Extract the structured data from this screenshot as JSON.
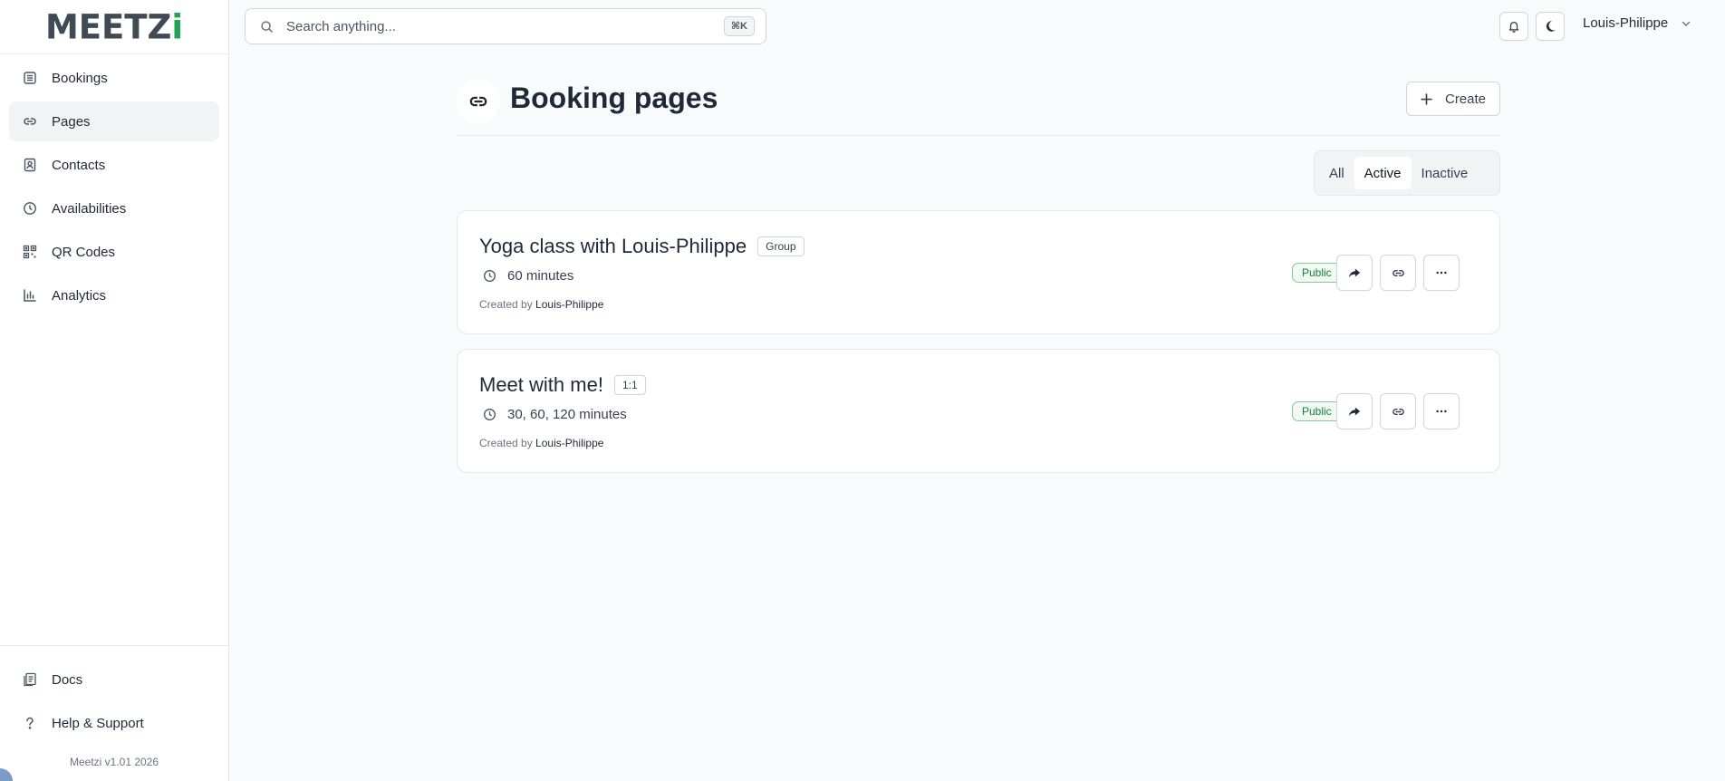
{
  "app": {
    "logo_main": "MEETZ",
    "logo_accent": "i",
    "version": "Meetzi v1.01 2026"
  },
  "sidebar": {
    "items": [
      {
        "label": "Bookings",
        "icon": "bookings-icon",
        "active": false
      },
      {
        "label": "Pages",
        "icon": "link-icon",
        "active": true
      },
      {
        "label": "Contacts",
        "icon": "contacts-icon",
        "active": false
      },
      {
        "label": "Availabilities",
        "icon": "clock-icon",
        "active": false
      },
      {
        "label": "QR Codes",
        "icon": "qr-code-icon",
        "active": false
      },
      {
        "label": "Analytics",
        "icon": "bar-chart-icon",
        "active": false
      }
    ],
    "bottom_items": [
      {
        "label": "Docs",
        "icon": "docs-icon"
      },
      {
        "label": "Help & Support",
        "icon": "question-icon"
      }
    ]
  },
  "header": {
    "search_placeholder": "Search anything...",
    "search_shortcut": "⌘K",
    "user_name": "Louis-Philippe"
  },
  "main": {
    "title": "Booking pages",
    "create_label": "Create",
    "filters": [
      {
        "label": "All",
        "active": false
      },
      {
        "label": "Active",
        "active": true
      },
      {
        "label": "Inactive",
        "active": false
      }
    ],
    "pages": [
      {
        "title": "Yoga class with Louis-Philippe",
        "type": "Group",
        "duration": "60 minutes",
        "created_prefix": "Created by",
        "author": "Louis-Philippe",
        "status": "Public"
      },
      {
        "title": "Meet with me!",
        "type": "1:1",
        "duration": "30, 60, 120 minutes",
        "created_prefix": "Created by",
        "author": "Louis-Philippe",
        "status": "Public"
      }
    ]
  },
  "colors": {
    "accent_green": "#22a455",
    "logo_gray": "#3f4a55",
    "public_badge": "#15803d",
    "background": "#f8fafc"
  }
}
